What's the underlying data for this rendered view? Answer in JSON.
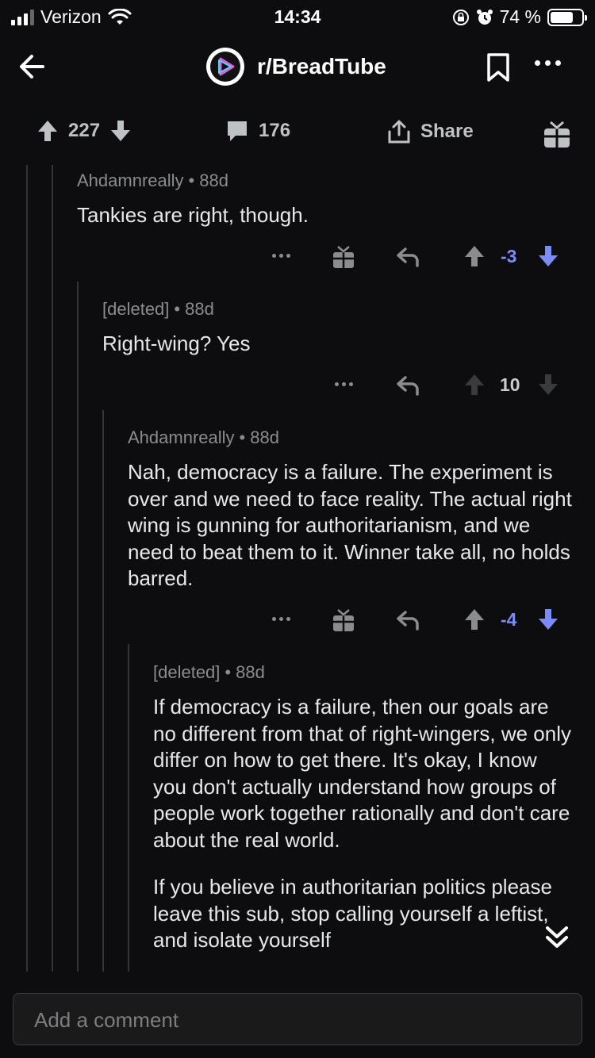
{
  "status": {
    "carrier": "Verizon",
    "time": "14:34",
    "battery": "74 %",
    "battery_level": 0.74
  },
  "header": {
    "subreddit": "r/BreadTube"
  },
  "post_actions": {
    "score": "227",
    "comments": "176",
    "share": "Share"
  },
  "comments": [
    {
      "author": "Ahdamnreally",
      "age": "88d",
      "text": "Tankies are right, though.",
      "score": "-3"
    },
    {
      "author": "[deleted]",
      "age": "88d",
      "text": "Right-wing? Yes",
      "score": "10"
    },
    {
      "author": "Ahdamnreally",
      "age": "88d",
      "text": "Nah, democracy is a failure. The experiment is over and we need to face reality. The actual right wing is gunning for authoritarianism, and we need to beat them to it. Winner take all, no holds barred.",
      "score": "-4"
    },
    {
      "author": "[deleted]",
      "age": "88d",
      "paragraphs": [
        "If democracy is a failure, then our goals are no different from that of right-wingers, we only differ on how to get there. It's okay, I know you don't actually understand how groups of people work together rationally and don't care about the real world.",
        "If you believe in authoritarian politics please leave this sub, stop calling yourself a leftist, and isolate yourself"
      ]
    }
  ],
  "composer": {
    "placeholder": "Add a comment"
  },
  "colors": {
    "downvote": "#7b8cf8",
    "background": "#0d0d0f"
  }
}
